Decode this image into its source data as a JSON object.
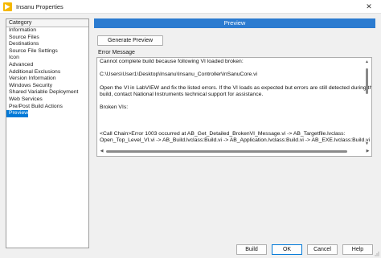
{
  "window": {
    "title": "Insanu Properties"
  },
  "category": {
    "header": "Category",
    "items": [
      "Information",
      "Source Files",
      "Destinations",
      "Source File Settings",
      "Icon",
      "Advanced",
      "Additional Exclusions",
      "Version Information",
      "Windows Security",
      "Shared Variable Deployment",
      "Web Services",
      "Pre/Post Build Actions",
      "Preview"
    ],
    "selected": "Preview"
  },
  "preview": {
    "header": "Preview",
    "generate_button": "Generate Preview",
    "error_label": "Error Message",
    "error_lines": [
      "Cannot complete build because following VI loaded broken:",
      "",
      "C:\\Users\\User1\\Desktop\\Insanu\\Insanu_Controller\\InSanuCore.vi",
      "",
      "Open the VI in LabVIEW and fix the listed errors. If the VI loads as expected but errors are still detected during the",
      "build, contact National Instruments technical support for assistance.",
      "",
      "Broken VIs:",
      "",
      "",
      "",
      "<Call Chain>Error 1003 occurred at AB_Get_Detailed_BrokenVI_Message.vi -> AB_Targetfile.lvclass:",
      "Open_Top_Level_VI.vi -> AB_Build.lvclass:Build.vi -> AB_Application.lvclass:Build.vi -> AB_EXE.lvclass:Build.vi"
    ]
  },
  "buttons": {
    "build": "Build",
    "ok": "OK",
    "cancel": "Cancel",
    "help": "Help"
  },
  "colors": {
    "accent": "#2b7bd0",
    "selection": "#0078d7",
    "app_icon": "#f5b800"
  }
}
